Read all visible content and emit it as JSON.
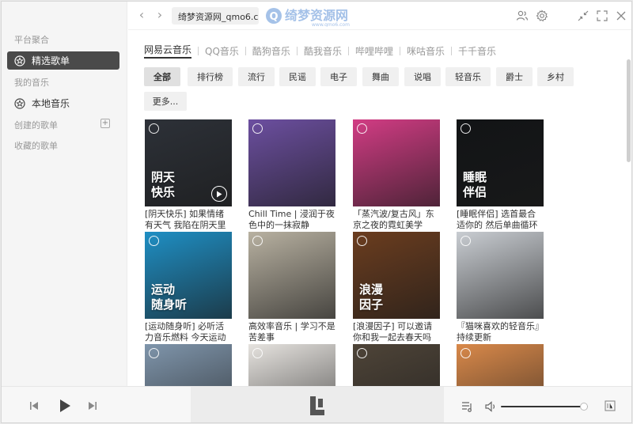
{
  "sidebar": {
    "section_platform": "平台聚合",
    "featured_label": "精选歌单",
    "section_my_music": "我的音乐",
    "local_music_label": "本地音乐",
    "section_created": "创建的歌单",
    "add_symbol": "+",
    "section_saved": "收藏的歌单"
  },
  "topbar": {
    "back_glyph": "‹",
    "forward_glyph": "›",
    "search_value": "绮梦资源网_qmo6.com"
  },
  "sources": [
    "网易云音乐",
    "QQ音乐",
    "酷狗音乐",
    "酷我音乐",
    "哔哩哔哩",
    "咪咕音乐",
    "千千音乐"
  ],
  "categories": [
    "全部",
    "排行榜",
    "流行",
    "民谣",
    "电子",
    "舞曲",
    "说唱",
    "轻音乐",
    "爵士",
    "乡村",
    "更多..."
  ],
  "playlists": [
    {
      "cover_title_1": "阴天",
      "cover_title_2": "快乐",
      "caption": "[阴天快乐] 如果情绪有天气 我陷在阴天里",
      "bg": "#2d3138"
    },
    {
      "cover_title_1": "",
      "cover_title_2": "",
      "caption": "Chill Time | 浸润于夜色中的一抹寂静",
      "bg": "#6c4fa0"
    },
    {
      "cover_title_1": "",
      "cover_title_2": "",
      "caption": "「蒸汽波/复古风」东京之夜的霓虹美学",
      "bg": "#d23c84"
    },
    {
      "cover_title_1": "睡眠",
      "cover_title_2": "伴侣",
      "caption": "[睡眠伴侣] 选首最合适你的 然后单曲循环",
      "bg": "#121416"
    },
    {
      "cover_title_1": "运动",
      "cover_title_2": "随身听",
      "caption": "[运动随身听] 必听活力音乐燃料 今天运动了吗",
      "bg": "#1f8fc4"
    },
    {
      "cover_title_1": "",
      "cover_title_2": "",
      "caption": "高效率音乐 | 学习不是苦差事",
      "bg": "#b8b1a1"
    },
    {
      "cover_title_1": "浪漫",
      "cover_title_2": "因子",
      "caption": "[浪漫因子] 可以邀请你和我一起去春天吗",
      "bg": "#6b3d1f"
    },
    {
      "cover_title_1": "",
      "cover_title_2": "",
      "caption": "『猫咪喜欢的轻音乐』持续更新",
      "bg": "#c9cdd2"
    },
    {
      "cover_title_1": "",
      "cover_title_2": "",
      "caption": "",
      "bg": "#7f95ab"
    },
    {
      "cover_title_1": "",
      "cover_title_2": "",
      "caption": "",
      "bg": "#e6e3df"
    },
    {
      "cover_title_1": "",
      "cover_title_2": "",
      "caption": "",
      "bg": "#4e4438"
    },
    {
      "cover_title_1": "",
      "cover_title_2": "",
      "caption": "",
      "bg": "#d9894a"
    }
  ],
  "player": {
    "volume": 0.95
  },
  "colors": {
    "active_nav": "#4a4a4a",
    "chip_bg": "#f0f0f0",
    "watermark": "#5b8fd6"
  }
}
